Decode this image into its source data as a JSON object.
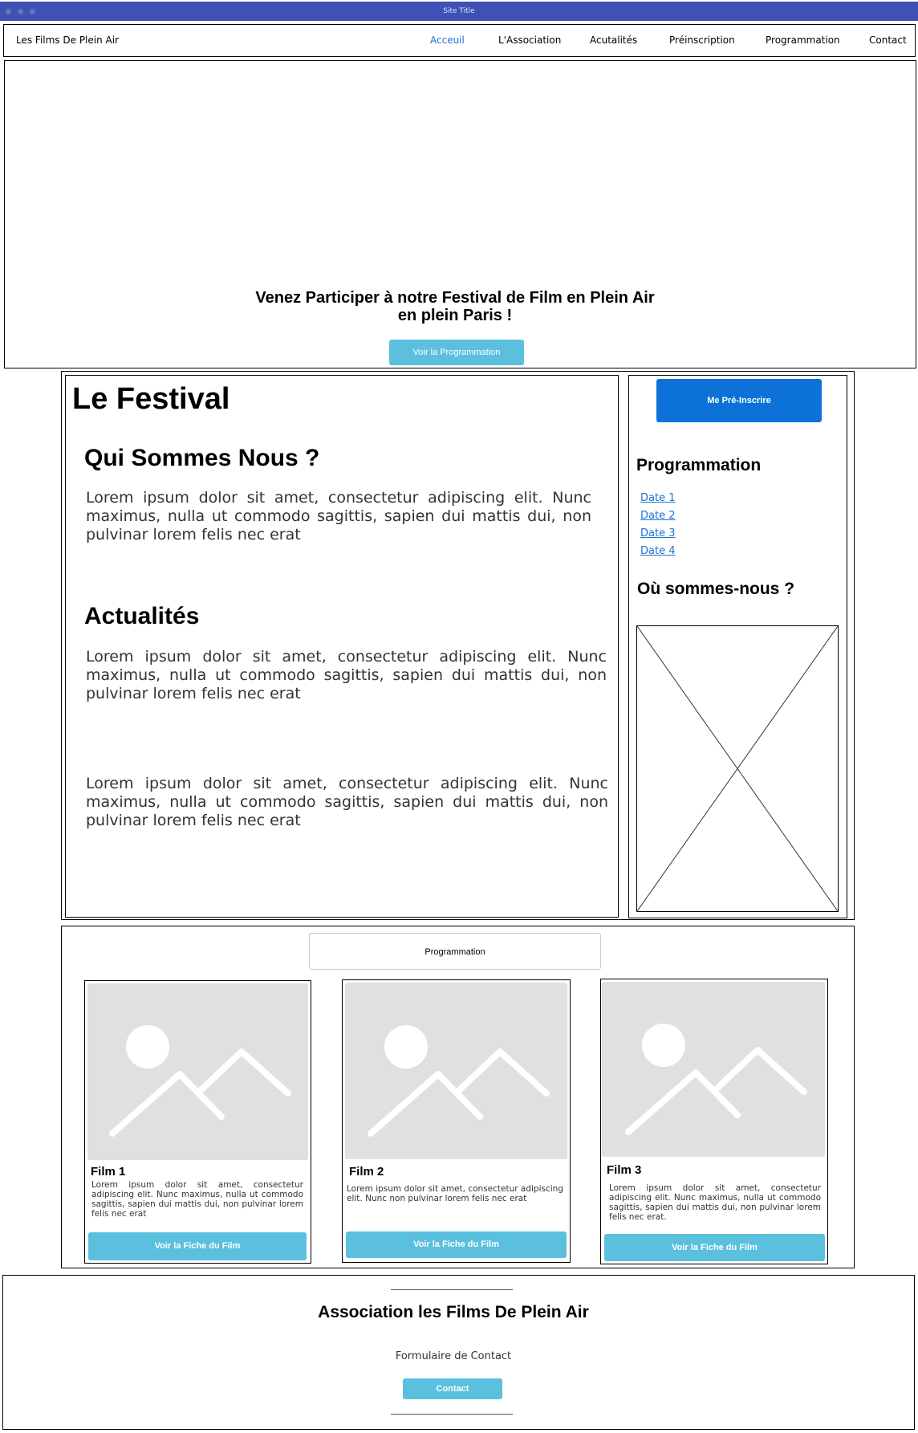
{
  "window": {
    "title": "Site Title"
  },
  "nav": {
    "brand": "Les Films De Plein Air",
    "links": [
      "Acceuil",
      "L'Association",
      "Acutalités",
      "Préinscription",
      "Programmation",
      "Contact"
    ]
  },
  "hero": {
    "headline_line1": "Venez Participer à notre Festival de Film en Plein Air",
    "headline_line2": "en plein Paris !",
    "cta": "Voir la Programmation"
  },
  "festival": {
    "title": "Le Festival",
    "sections": [
      {
        "heading": "Qui Sommes Nous ?",
        "text": "Lorem ipsum dolor sit amet, consectetur adipiscing elit. Nunc maximus, nulla ut commodo sagittis, sapien dui mattis dui, non pulvinar lorem felis nec erat"
      },
      {
        "heading": "Actualités",
        "text": "Lorem ipsum dolor sit amet, consectetur adipiscing elit. Nunc maximus, nulla ut commodo sagittis, sapien dui mattis dui, non pulvinar lorem felis nec erat"
      }
    ],
    "extra_text": "Lorem ipsum dolor sit amet, consectetur adipiscing elit. Nunc maximus, nulla ut commodo sagittis, sapien dui mattis dui, non pulvinar lorem felis nec erat"
  },
  "sidebar": {
    "register_button": "Me Pré-Inscrire",
    "programmation_heading": "Programmation",
    "dates": [
      "Date 1",
      "Date 2",
      "Date 3",
      "Date 4"
    ],
    "location_heading": "Où sommes-nous ?"
  },
  "programmation": {
    "title": "Programmation",
    "films": [
      {
        "title": "Film 1",
        "text": "Lorem ipsum dolor sit amet, consectetur adipiscing elit. Nunc maximus, nulla ut commodo sagittis, sapien dui mattis dui, non pulvinar lorem felis nec erat",
        "button": "Voir la Fiche du Film"
      },
      {
        "title": "Film 2",
        "text": "Lorem ipsum dolor sit amet, consectetur adipiscing elit. Nunc non pulvinar lorem felis nec erat",
        "button": "Voir la Fiche du Film"
      },
      {
        "title": "Film 3",
        "text": "Lorem ipsum dolor sit amet, consectetur adipiscing elit. Nunc maximus, nulla ut commodo sagittis, sapien dui mattis dui, non pulvinar lorem felis nec erat.",
        "button": "Voir la Fiche du Film"
      }
    ]
  },
  "footer": {
    "organization": "Association les Films De Plein Air",
    "form_label": "Formulaire de Contact",
    "contact_button": "Contact"
  },
  "colors": {
    "titlebar": "#3f51b5",
    "active_link": "#1a73d1",
    "button_light": "#5bc0de",
    "button_primary": "#0d72d8",
    "image_placeholder": "#e0e0e0"
  },
  "icons": {
    "image_placeholder": "image-placeholder-icon",
    "map_placeholder": "map-placeholder-icon"
  }
}
